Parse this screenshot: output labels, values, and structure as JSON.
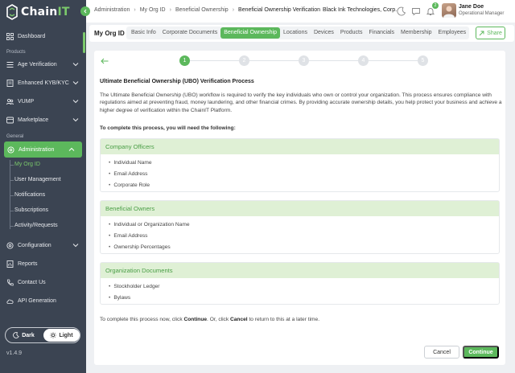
{
  "brand": {
    "name_main": "Chain",
    "name_accent": "IT",
    "accent_color": "#5cb85c",
    "sidebar_color": "#3b4452"
  },
  "sidebar": {
    "items_top": [
      {
        "label": "Dashboard",
        "icon": "grid-icon"
      }
    ],
    "section_products": "Products",
    "products": [
      {
        "label": "Age Verification",
        "icon": "list-icon"
      },
      {
        "label": "Enhanced KYB/KYC",
        "icon": "document-icon"
      },
      {
        "label": "VUMP",
        "icon": "users-icon"
      },
      {
        "label": "Marketplace",
        "icon": "store-icon"
      }
    ],
    "section_general": "General",
    "administration": {
      "label": "Administration",
      "icon": "gear-icon"
    },
    "admin_sub": [
      {
        "label": "My Org ID"
      },
      {
        "label": "User Management"
      },
      {
        "label": "Notifications"
      },
      {
        "label": "Subscriptions"
      },
      {
        "label": "Activity/Requests"
      }
    ],
    "general": [
      {
        "label": "Configuration",
        "icon": "cog-icon"
      },
      {
        "label": "Reports",
        "icon": "report-icon"
      },
      {
        "label": "Contact Us",
        "icon": "phone-icon"
      },
      {
        "label": "API Generation",
        "icon": "cloud-icon"
      }
    ],
    "theme": {
      "dark": "Dark",
      "light": "Light"
    },
    "version": "v1.4.9"
  },
  "header": {
    "breadcrumbs": [
      "Administration",
      "My Org ID",
      "Beneficial Ownership",
      "Beneficial Ownership Verification"
    ],
    "org_name": "Black Ink Technologies, Corp.",
    "notification_count": "2",
    "user": {
      "name": "Jane Doe",
      "role": "Operational Manager"
    }
  },
  "tabs": {
    "title": "My Org ID",
    "items": [
      "Basic Info",
      "Corporate Documents",
      "Beneficial Ownership",
      "Locations",
      "Devices",
      "Products",
      "Financials",
      "Membership",
      "Employees"
    ],
    "active": "Beneficial Ownership",
    "share_label": "Share"
  },
  "stepper": {
    "steps": [
      "1",
      "2",
      "3",
      "4",
      "5"
    ],
    "current": 1
  },
  "content": {
    "title": "Ultimate Beneficial Ownership (UBO) Verification Process",
    "intro": "The Ultimate Beneficial Ownership (UBO) workflow is required to verify the key individuals who own or control your organization. This process ensures compliance with regulations aimed at preventing fraud, money laundering, and other financial crimes. By providing accurate ownership details, you help protect your business and achieve a higher degree of verification within the ChainIT Platform.",
    "need": "To complete this process, you will need the following:",
    "sections": [
      {
        "title": "Company Officers",
        "items": [
          "Individual Name",
          "Email Address",
          "Corporate Role"
        ]
      },
      {
        "title": "Beneficial Owners",
        "items": [
          "Individual or Organization Name",
          "Email Address",
          "Ownership Percentages"
        ]
      },
      {
        "title": "Organization Documents",
        "items": [
          "Stockholder Ledger",
          "Bylaws"
        ]
      }
    ],
    "closing_pre": "To complete this process now, click ",
    "closing_continue": "Continue",
    "closing_mid": ". Or, click ",
    "closing_cancel": "Cancel",
    "closing_post": " to return to this at a later time.",
    "cancel_label": "Cancel",
    "continue_label": "Continue"
  }
}
